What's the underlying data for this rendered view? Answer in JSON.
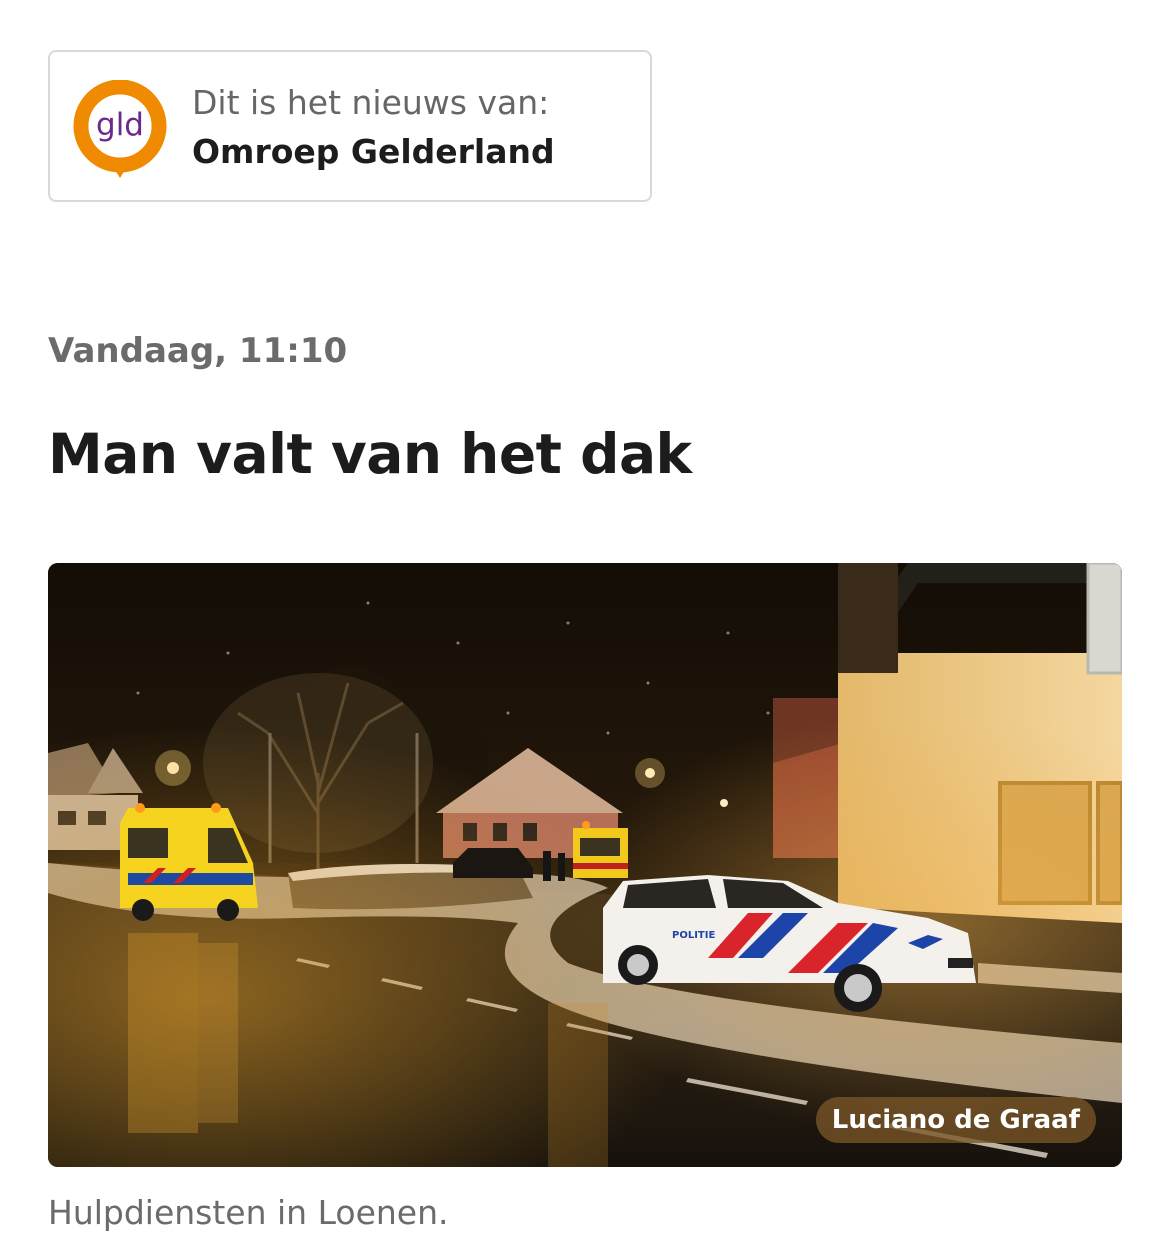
{
  "source": {
    "intro": "Dit is het nieuws van:",
    "name": "Omroep Gelderland",
    "logo_text": "gld",
    "logo_ring_color": "#f08a00",
    "logo_text_color": "#6a2a8c"
  },
  "article": {
    "timestamp": "Vandaag, 11:10",
    "title": "Man valt van het dak",
    "photo": {
      "credit": "Luciano de Graaf",
      "police_label": "POLITIE"
    },
    "caption": "Hulpdiensten in Loenen."
  }
}
